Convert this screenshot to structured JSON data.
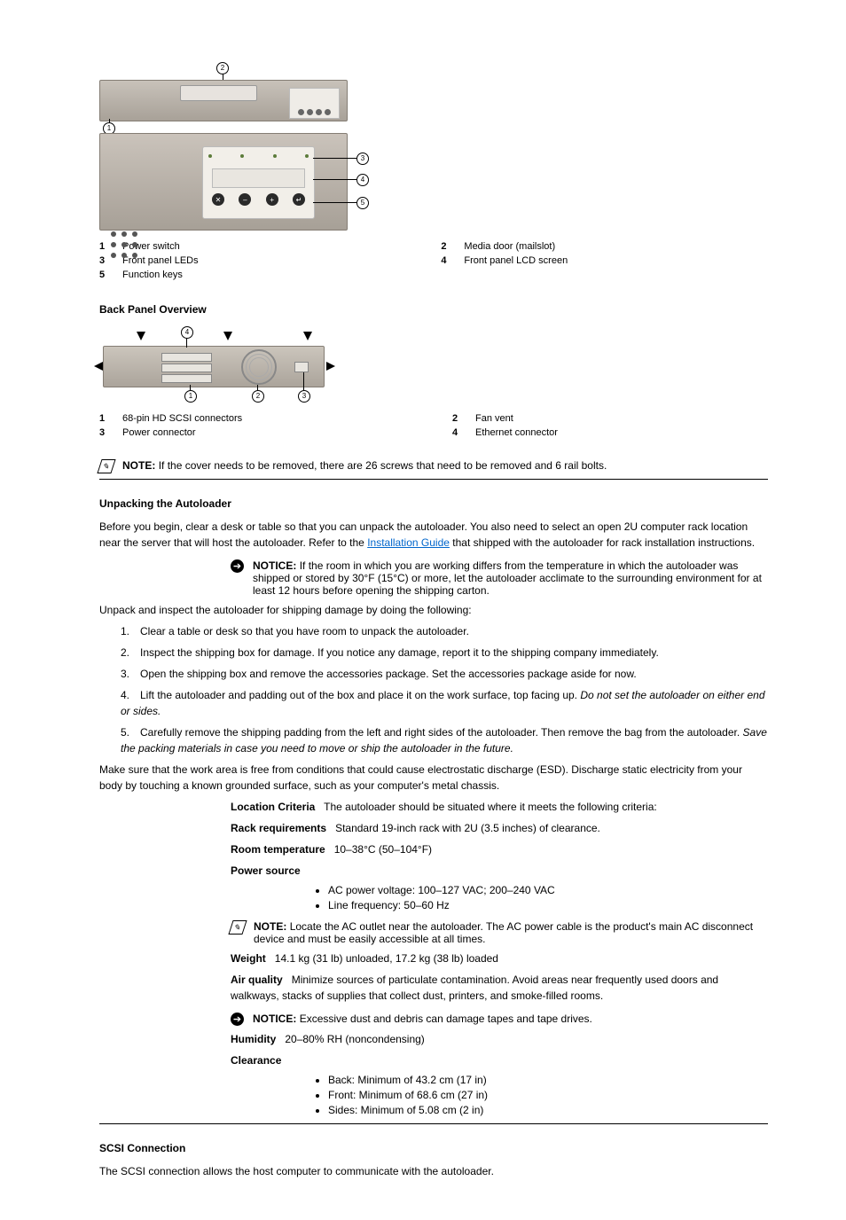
{
  "figure1": {
    "callouts": [
      "1",
      "2",
      "3",
      "4",
      "5"
    ],
    "legend": [
      {
        "n": "1",
        "t": "Power switch"
      },
      {
        "n": "2",
        "t": "Media door (mailslot)"
      },
      {
        "n": "3",
        "t": "Front panel LEDs"
      },
      {
        "n": "4",
        "t": "Front panel LCD screen"
      },
      {
        "n": "5",
        "t": "Function keys"
      }
    ]
  },
  "section_back": {
    "title": "Back Panel Overview"
  },
  "figure2": {
    "callouts": [
      "1",
      "2",
      "3",
      "4"
    ],
    "legend": [
      {
        "n": "1",
        "t": "68-pin HD SCSI connectors"
      },
      {
        "n": "2",
        "t": "Fan vent"
      },
      {
        "n": "3",
        "t": "Power connector"
      },
      {
        "n": "4",
        "t": "Ethernet connector"
      }
    ]
  },
  "note1": {
    "label": "NOTE:",
    "text": "If the cover needs to be removed, there are 26 screws that need to be removed and 6 rail bolts."
  },
  "unpack": {
    "title": "Unpacking the Autoloader",
    "p1_pre": "Before you begin, clear a desk or table so that you can unpack the autoloader. You also need to select an open 2U computer rack location near the server that will host the autoloader. Refer to the ",
    "p1_link": "Installation Guide",
    "p1_post": " that shipped with the autoloader for rack installation instructions.",
    "notice1": {
      "label": "NOTICE:",
      "text": "If the room in which you are working differs from the temperature in which the autoloader was shipped or stored by 30°F (15°C) or more, let the autoloader acclimate to the surrounding environment for at least 12 hours before opening the shipping carton."
    },
    "p2": "Unpack and inspect the autoloader for shipping damage by doing the following:",
    "steps_label": "",
    "step1": {
      "n": "1.",
      "t": "Clear a table or desk so that you have room to unpack the autoloader."
    },
    "step2": {
      "n": "2.",
      "t": "Inspect the shipping box for damage. If you notice any damage, report it to the shipping company immediately."
    },
    "step3": {
      "n": "3.",
      "t": "Open the shipping box and remove the accessories package. Set the accessories package aside for now."
    },
    "step4": {
      "n": "4.",
      "t": "Lift the autoloader and padding out of the box and place it on the work surface, top facing up. ",
      "em": "Do not set the autoloader on either end or sides."
    },
    "step5": {
      "n": "5.",
      "t": "Carefully remove the shipping padding from the left and right sides of the autoloader. Then remove the bag from the autoloader. ",
      "em": "Save the packing materials in case you need to move or ship the autoloader in the future."
    },
    "p3": "Make sure that the work area is free from conditions that could cause electrostatic discharge (ESD). Discharge static electricity from your body by touching a known grounded surface, such as your computer's metal chassis."
  },
  "location": {
    "title": "Location Criteria",
    "intro_lead": "Location Criteria",
    "intro": "The autoloader should be situated where it meets the following criteria:",
    "rows": [
      {
        "k": "Rack requirements",
        "v": "Standard 19-inch rack with 2U (3.5 inches) of clearance."
      },
      {
        "k": "Room temperature",
        "v": "10–38°C (50–104°F)"
      },
      {
        "k": "Power source",
        "v": [
          "AC power voltage: 100–127 VAC; 200–240 VAC",
          "Line frequency: 50–60 Hz"
        ]
      },
      {
        "k": "",
        "note": {
          "label": "NOTE:",
          "text": "Locate the AC outlet near the autoloader. The AC power cable is the product's main AC disconnect device and must be easily accessible at all times."
        }
      },
      {
        "k": "Weight",
        "v": "14.1 kg (31 lb) unloaded, 17.2 kg (38 lb) loaded"
      },
      {
        "k": "Air quality",
        "v": "Minimize sources of particulate contamination. Avoid areas near frequently used doors and walkways, stacks of supplies that collect dust, printers, and smoke-filled rooms."
      },
      {
        "k": "",
        "notice": {
          "label": "NOTICE:",
          "text": "Excessive dust and debris can damage tapes and tape drives."
        }
      },
      {
        "k": "Humidity",
        "v": "20–80% RH (noncondensing)"
      },
      {
        "k": "Clearance",
        "v": [
          "Back: Minimum of 43.2 cm (17 in)",
          "Front: Minimum of 68.6 cm (27 in)",
          "Sides: Minimum of 5.08 cm (2 in)"
        ]
      }
    ]
  },
  "scsi": {
    "title": "SCSI Connection",
    "p": "The SCSI connection allows the host computer to communicate with the autoloader."
  }
}
